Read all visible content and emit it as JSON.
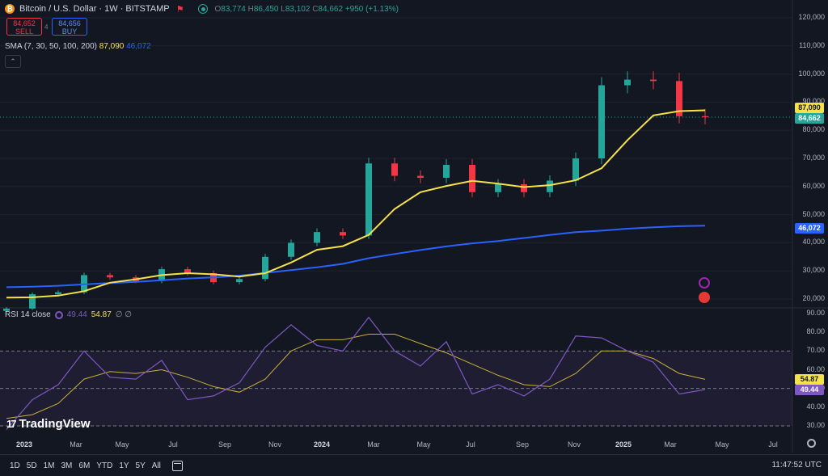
{
  "header": {
    "title": "Bitcoin / U.S. Dollar · 1W · BITSTAMP",
    "icon": "bitcoin-icon",
    "ohlc": {
      "o_label": "O",
      "o": "83,774",
      "h_label": "H",
      "h": "86,450",
      "l_label": "L",
      "l": "83,102",
      "c_label": "C",
      "c": "84,662",
      "change": "+950 (+1.13%)"
    }
  },
  "trade": {
    "sell_price": "84,652",
    "sell_label": "SELL",
    "spread": "4",
    "buy_price": "84,656",
    "buy_label": "BUY"
  },
  "sma": {
    "label": "SMA (7, 30, 50, 100, 200)",
    "value1": "87,090",
    "value2": "46,072"
  },
  "collapse": "⌃",
  "rsi": {
    "label": "RSI 14 close",
    "value1": "49.44",
    "value2": "54.87",
    "rest": "∅ ∅"
  },
  "price_axis": [
    "120,000",
    "110,000",
    "100,000",
    "90,000",
    "80,000",
    "70,000",
    "60,000",
    "50,000",
    "40,000",
    "30,000",
    "20,000"
  ],
  "rsi_axis": [
    "90.00",
    "80.00",
    "70.00",
    "60.00",
    "50.00",
    "40.00",
    "30.00"
  ],
  "price_tags": [
    {
      "text": "87,090",
      "bg": "#f5e24a",
      "fg": "#131722"
    },
    {
      "text": "84,662",
      "bg": "#26a69a",
      "fg": "#ffffff"
    },
    {
      "text": "46,072",
      "bg": "#2962ff",
      "fg": "#ffffff"
    },
    {
      "text": "54.87",
      "bg": "#f5e24a",
      "fg": "#131722"
    },
    {
      "text": "49.44",
      "bg": "#7e57c2",
      "fg": "#ffffff"
    }
  ],
  "time_axis": [
    {
      "text": "2023",
      "bold": true
    },
    {
      "text": "Mar"
    },
    {
      "text": "May"
    },
    {
      "text": "Jul"
    },
    {
      "text": "Sep"
    },
    {
      "text": "Nov"
    },
    {
      "text": "2024",
      "bold": true
    },
    {
      "text": "Mar"
    },
    {
      "text": "May"
    },
    {
      "text": "Jul"
    },
    {
      "text": "Sep"
    },
    {
      "text": "Nov"
    },
    {
      "text": "2025",
      "bold": true
    },
    {
      "text": "Mar"
    },
    {
      "text": "May"
    },
    {
      "text": "Jul"
    }
  ],
  "ranges": [
    "1D",
    "5D",
    "1M",
    "3M",
    "6M",
    "YTD",
    "1Y",
    "5Y",
    "All"
  ],
  "clock": "11:47:52 UTC",
  "logo": "TradingView",
  "colors": {
    "up": "#26a69a",
    "down": "#f23645",
    "sma_short": "#f5e24a",
    "sma_long": "#2962ff",
    "rsi": "#7e57c2",
    "rsi_ma": "#c9b03c",
    "bg": "#131722"
  },
  "chart_data": {
    "type": "candlestick",
    "interval": "1W",
    "x": [
      "2023-01-01",
      "2023-02-05",
      "2023-03-05",
      "2023-04-02",
      "2023-05-07",
      "2023-06-04",
      "2023-07-02",
      "2023-08-06",
      "2023-09-03",
      "2023-10-01",
      "2023-11-05",
      "2023-12-03",
      "2024-01-07",
      "2024-02-04",
      "2024-03-03",
      "2024-04-07",
      "2024-05-05",
      "2024-06-02",
      "2024-07-07",
      "2024-08-04",
      "2024-09-01",
      "2024-10-06",
      "2024-11-03",
      "2024-12-01",
      "2025-01-05",
      "2025-02-02",
      "2025-03-02",
      "2025-03-23"
    ],
    "close": [
      16600,
      21700,
      22400,
      28500,
      27700,
      26400,
      30600,
      29200,
      26000,
      27100,
      35000,
      40000,
      43800,
      42600,
      68200,
      63800,
      63100,
      67700,
      58000,
      60800,
      58000,
      62100,
      70000,
      96000,
      98000,
      97500,
      85000,
      84662
    ],
    "sma_short": [
      20500,
      20600,
      21200,
      22800,
      25800,
      27000,
      28500,
      29200,
      28800,
      28000,
      29200,
      33000,
      37500,
      38800,
      42800,
      52000,
      58000,
      60200,
      62000,
      61000,
      59800,
      60500,
      62200,
      66500,
      76500,
      85300,
      86800,
      87090
    ],
    "sma_long": [
      24200,
      24400,
      24700,
      25200,
      25700,
      26100,
      26700,
      27300,
      27700,
      28300,
      29300,
      30300,
      31300,
      32500,
      34500,
      36000,
      37400,
      38700,
      39800,
      40600,
      41700,
      42800,
      43800,
      44300,
      45000,
      45500,
      45900,
      46072
    ],
    "rsi": [
      28,
      44,
      52,
      70,
      56,
      55,
      65,
      44,
      46,
      53,
      72,
      84,
      73,
      70,
      88,
      70,
      62,
      75,
      47,
      52,
      46,
      55,
      78,
      77,
      70,
      64,
      47,
      49.44
    ],
    "rsi_ma": [
      34,
      36,
      42,
      55,
      59,
      58,
      60,
      56,
      51,
      48,
      55,
      70,
      76,
      76,
      79,
      79,
      74,
      69,
      63,
      57,
      52,
      51,
      58,
      70,
      70,
      66,
      58,
      54.87
    ],
    "ylim": [
      18000,
      122000
    ],
    "rsi_ylim": [
      26,
      94
    ]
  }
}
